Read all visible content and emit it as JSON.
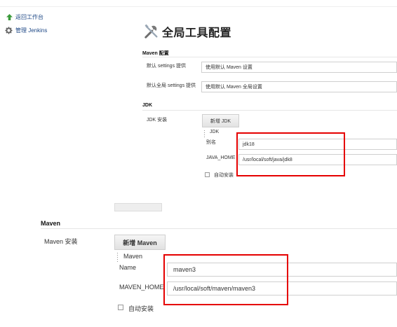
{
  "sidebar": {
    "items": [
      {
        "label": "返回工作台",
        "icon": "arrow-up-icon"
      },
      {
        "label": "管理 Jenkins",
        "icon": "gear-icon"
      }
    ]
  },
  "page": {
    "title": "全局工具配置",
    "title_icon": "tools-icon"
  },
  "maven_config": {
    "section_title": "Maven 配置",
    "settings_label": "默认 settings 提供",
    "settings_value": "使用默认 Maven 设置",
    "global_settings_label": "默认全局 settings 提供",
    "global_settings_value": "使用默认 Maven 全局设置"
  },
  "jdk": {
    "section_title": "JDK",
    "install_label": "JDK 安装",
    "add_button": "新增 JDK",
    "item_header": "JDK",
    "name_label": "别名",
    "name_value": "jdk18",
    "home_label": "JAVA_HOME",
    "home_value": "/usr/local/soft/java/jdk8",
    "auto_install_label": "自动安装"
  },
  "maven": {
    "section_title": "Maven",
    "install_label": "Maven 安装",
    "add_button": "新增 Maven",
    "item_header": "Maven",
    "name_label": "Name",
    "name_value": "maven3",
    "home_label": "MAVEN_HOME",
    "home_value": "/usr/local/soft/maven/maven3",
    "auto_install_label": "自动安装"
  },
  "colors": {
    "highlight": "#e50000",
    "link": "#204a87"
  }
}
